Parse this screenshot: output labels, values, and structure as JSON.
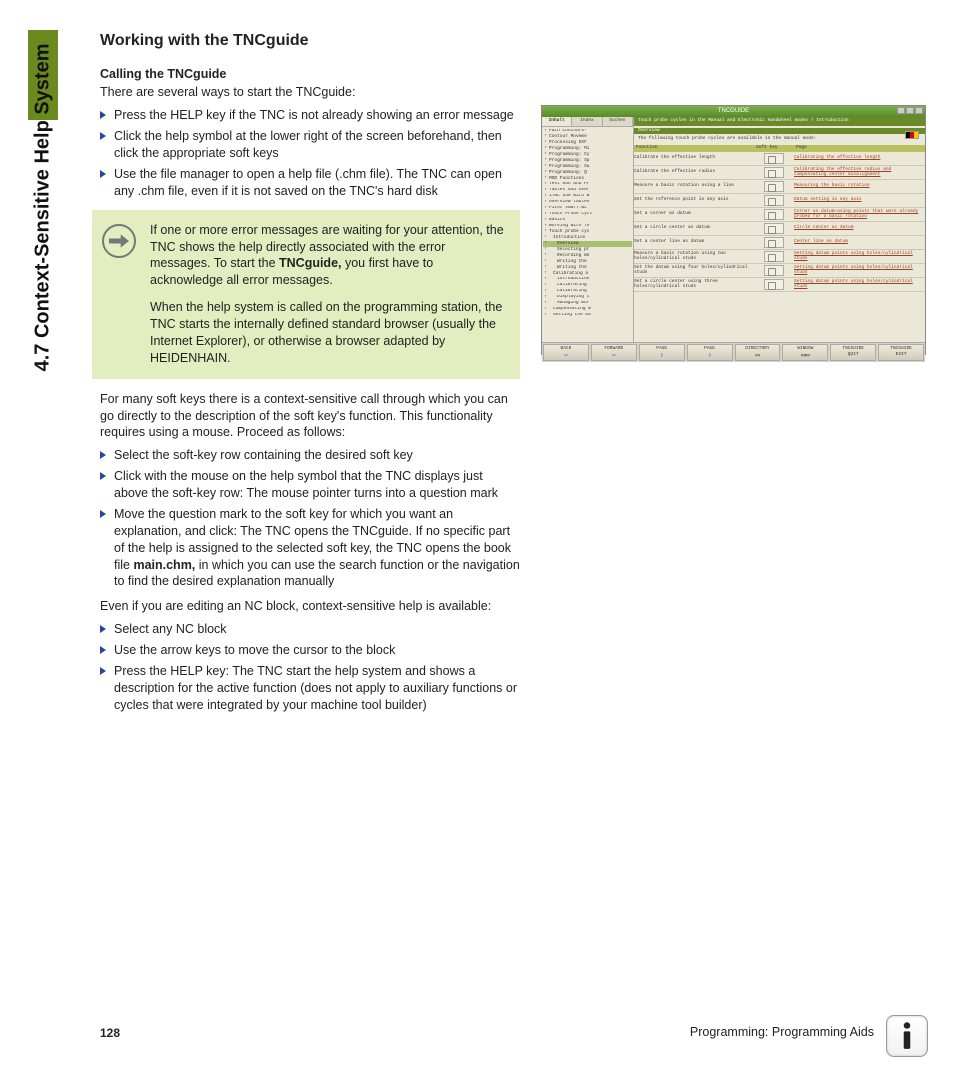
{
  "sidebar": {
    "section_label": "4.7 Context-Sensitive Help System"
  },
  "heading": "Working with the TNCguide",
  "subheading": "Calling the TNCguide",
  "intro": "There are several ways to start the TNCguide:",
  "list1": [
    "Press the HELP key if the TNC is not already showing an error message",
    "Click the help symbol at the lower right of the screen beforehand, then click the appropriate soft keys",
    "Use the file manager to open a help file (.chm file). The TNC can open any .chm file, even if it is not saved on the TNC's hard disk"
  ],
  "note": {
    "p1a": "If one or more error messages are waiting for your attention, the TNC shows the help directly associated with the error messages. To start the ",
    "p1b": "TNCguide,",
    "p1c": " you first have to acknowledge all error messages.",
    "p2": "When the help system is called on the programming station, the TNC starts the internally defined standard browser (usually the Internet Explorer), or otherwise a browser adapted by HEIDENHAIN."
  },
  "mid": "For many soft keys there is a context-sensitive call through which you can go directly to the description of the soft key's function. This functionality requires using a mouse. Proceed as follows:",
  "list2": [
    {
      "t": "Select the soft-key row containing the desired soft key"
    },
    {
      "t": "Click with the mouse on the help symbol that the TNC displays just above the soft-key row: The mouse pointer turns into a question mark"
    },
    {
      "pre": "Move the question mark to the soft key for which you want an explanation, and click: The TNC opens the TNCguide. If no specific part of the help is assigned to the selected soft key, the TNC opens the book file ",
      "bold": "main.chm,",
      "post": " in which you can use the search function or the navigation to find the desired explanation manually"
    }
  ],
  "mid2": "Even if you are editing an NC block, context-sensitive help is available:",
  "list3": [
    "Select any NC block",
    "Use the arrow keys to move the cursor to the block",
    "Press the HELP key: The TNC start the help system and shows a description for the active function (does not apply to auxiliary functions or cycles that were integrated by your machine tool builder)"
  ],
  "footer": {
    "page": "128",
    "chapter": "Programming: Programming Aids"
  },
  "shot": {
    "title": "TNCGUIDE",
    "tabs": [
      "Inhalt",
      "Index",
      "Suchen"
    ],
    "tree": [
      {
        "t": "Path Contours-",
        "l": 1
      },
      {
        "t": "Contour Moveme",
        "l": 1
      },
      {
        "t": "Processing DXF",
        "l": 1
      },
      {
        "t": "Programming: Mi",
        "l": 0
      },
      {
        "t": "Programming: Cy",
        "l": 0
      },
      {
        "t": "Programming: Sp",
        "l": 0
      },
      {
        "t": "Programming: Su",
        "l": 0
      },
      {
        "t": "Programming: Q",
        "l": 0
      },
      {
        "t": "MOD Functions",
        "l": 0
      },
      {
        "t": "Test Run and Pr",
        "l": 0
      },
      {
        "t": "Tables and Over",
        "l": 0
      },
      {
        "t": "iTNC 530 with W",
        "l": 1
      },
      {
        "t": "Overview tables",
        "l": 1
      },
      {
        "t": "Pilot smarT.NC",
        "l": 0
      },
      {
        "t": "Touch Probe Cycl",
        "l": 0
      },
      {
        "t": "Basics",
        "l": 1
      },
      {
        "t": "Working with To",
        "l": 1
      },
      {
        "t": "Touch probe cyc",
        "l": 1
      },
      {
        "t": "Introduction",
        "l": 2
      },
      {
        "t": "Overview",
        "l": 3,
        "sel": true
      },
      {
        "t": "Selecting pr",
        "l": 3
      },
      {
        "t": "Recording me",
        "l": 3
      },
      {
        "t": "Writing the",
        "l": 3
      },
      {
        "t": "Writing the",
        "l": 3
      },
      {
        "t": "Calibrating a",
        "l": 2
      },
      {
        "t": "Introduction",
        "l": 3
      },
      {
        "t": "Calibrating",
        "l": 3
      },
      {
        "t": "Calibrating",
        "l": 3
      },
      {
        "t": "Displaying c",
        "l": 3
      },
      {
        "t": "Managing mor",
        "l": 3
      },
      {
        "t": "Compensating W",
        "l": 2
      },
      {
        "t": "Setting the Da",
        "l": 2
      }
    ],
    "crumb": "Touch probe cycles in the Manual and Electronic Handwheel modes / Introduction",
    "overview": "Overview",
    "topnote": "The following touch probe cycles are available in the manual mode:",
    "cols": [
      "Function",
      "Soft key",
      "Page"
    ],
    "rows": [
      {
        "f": "Calibrate the effective length",
        "p": "Calibrating the effective length"
      },
      {
        "f": "Calibrate the effective radius",
        "p": "Calibrating the effective radius and compensating center misalignment"
      },
      {
        "f": "Measure a basic rotation using a line",
        "p": "Measuring the basic rotation"
      },
      {
        "f": "Set the reference point in any axis",
        "p": "Datum setting in any axis"
      },
      {
        "f": "Set a corner as datum",
        "p": "Corner as datum—using points that were already probed for a basic rotation"
      },
      {
        "f": "Set a circle center as datum",
        "p": "Circle center as datum"
      },
      {
        "f": "Set a center line as datum",
        "p": "Center line as datum"
      },
      {
        "f": "Measure a basic rotation using two holes/cylindrical studs",
        "p": "Setting datum points using holes/cylindrical studs"
      },
      {
        "f": "Set the datum using four holes/cylindrical studs",
        "p": "Setting datum points using holes/cylindrical studs"
      },
      {
        "f": "Set a circle center using three holes/cylindrical studs",
        "p": "Setting datum points using holes/cylindrical studs"
      }
    ],
    "softkeys": [
      {
        "l": "BACK",
        "a": "⇦",
        "c": "blue"
      },
      {
        "l": "FORWARD",
        "a": "⇨",
        "c": "blue"
      },
      {
        "l": "PAGE",
        "a": "⇧",
        "c": "blue"
      },
      {
        "l": "PAGE",
        "a": "⇩",
        "c": "blue"
      },
      {
        "l": "DIRECTORY",
        "a": "▭"
      },
      {
        "l": "WINDOW",
        "a": "▭▭"
      },
      {
        "l": "TNCGUIDE",
        "l2": "QUIT"
      },
      {
        "l": "TNCGUIDE",
        "l2": "EXIT"
      }
    ]
  }
}
